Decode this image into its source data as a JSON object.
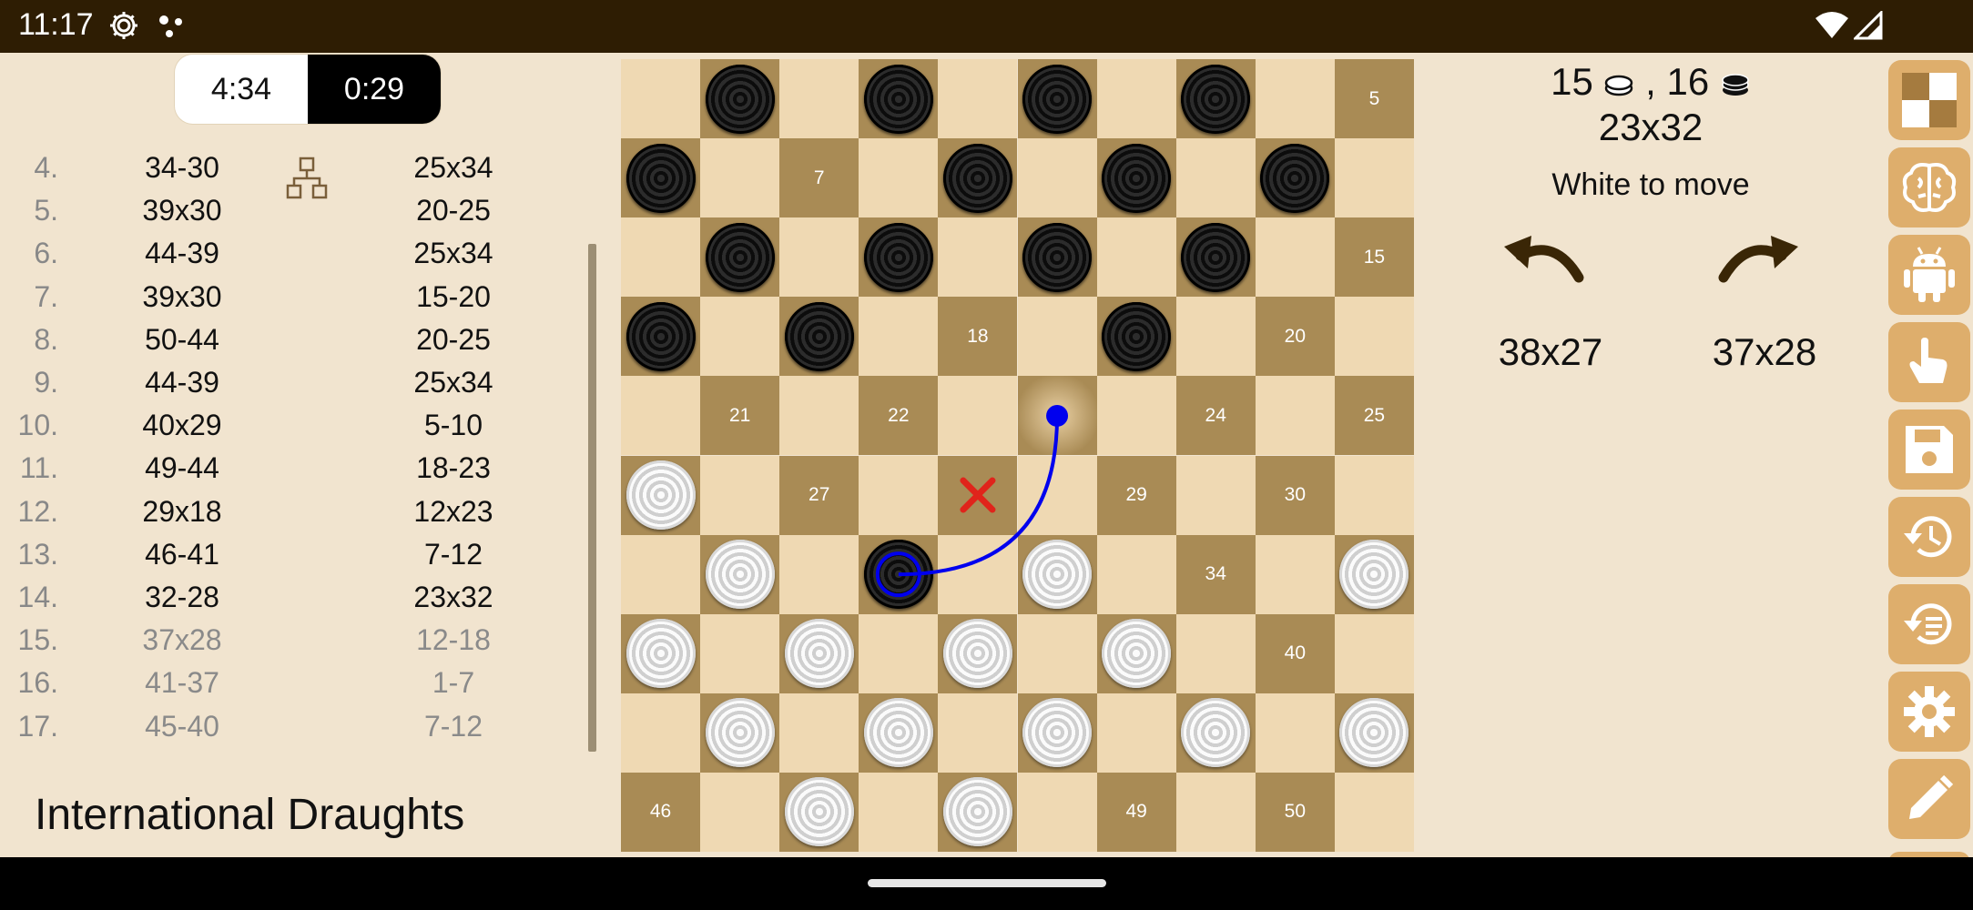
{
  "status_bar": {
    "time": "11:17",
    "icons": [
      "gear-icon",
      "dots-icon",
      "wifi-icon",
      "signal-icon"
    ]
  },
  "clock": {
    "white_time": "4:34",
    "black_time": "0:29"
  },
  "moves": [
    {
      "num": "4.",
      "white": "34-30",
      "black": "25x34",
      "future": false
    },
    {
      "num": "5.",
      "white": "39x30",
      "black": "20-25",
      "future": false
    },
    {
      "num": "6.",
      "white": "44-39",
      "black": "25x34",
      "future": false
    },
    {
      "num": "7.",
      "white": "39x30",
      "black": "15-20",
      "future": false
    },
    {
      "num": "8.",
      "white": "50-44",
      "black": "20-25",
      "future": false
    },
    {
      "num": "9.",
      "white": "44-39",
      "black": "25x34",
      "future": false
    },
    {
      "num": "10.",
      "white": "40x29",
      "black": "5-10",
      "future": false
    },
    {
      "num": "11.",
      "white": "49-44",
      "black": "18-23",
      "future": false
    },
    {
      "num": "12.",
      "white": "29x18",
      "black": "12x23",
      "future": false
    },
    {
      "num": "13.",
      "white": "46-41",
      "black": "7-12",
      "future": false
    },
    {
      "num": "14.",
      "white": "32-28",
      "black": "23x32",
      "future": false
    },
    {
      "num": "15.",
      "white": "37x28",
      "black": "12-18",
      "future": true
    },
    {
      "num": "16.",
      "white": "41-37",
      "black": "1-7",
      "future": true
    },
    {
      "num": "17.",
      "white": "45-40",
      "black": "7-12",
      "future": true
    }
  ],
  "game_title": "International Draughts",
  "board": {
    "light_color": "#efd9b3",
    "dark_color": "#a98b55",
    "highlight_square": 23,
    "shown_numbers": [
      5,
      7,
      15,
      18,
      20,
      21,
      22,
      24,
      25,
      27,
      29,
      30,
      34,
      40,
      46,
      49,
      50
    ],
    "black_pieces": [
      1,
      2,
      3,
      4,
      6,
      8,
      9,
      10,
      11,
      12,
      13,
      14,
      16,
      17,
      19,
      32
    ],
    "white_pieces": [
      26,
      31,
      33,
      35,
      36,
      37,
      38,
      39,
      41,
      42,
      43,
      44,
      45,
      48,
      47
    ],
    "move_arrow": {
      "from": 32,
      "to": 23,
      "color": "#0000ee"
    },
    "cross_square": 28,
    "cross_color": "#e0241b"
  },
  "info": {
    "white_count": "15",
    "black_count": "16",
    "last_move": "23x32",
    "to_move": "White to move",
    "prev_move": "38x27",
    "next_move": "37x28"
  },
  "toolbar": [
    "board-icon",
    "brain-icon",
    "android-icon",
    "hand-pointer-icon",
    "save-icon",
    "history-icon",
    "restore-icon",
    "settings-icon",
    "edit-icon"
  ]
}
